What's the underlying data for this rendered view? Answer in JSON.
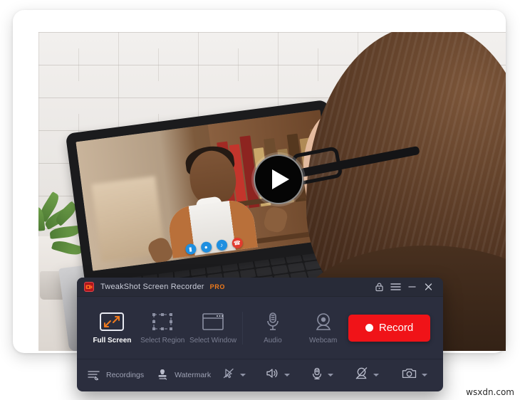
{
  "app": {
    "title": "TweakShot Screen Recorder",
    "badge": "PRO",
    "logo_icon": "app-logo-camera-icon"
  },
  "titlebar": {
    "buttons": [
      {
        "name": "lock-icon",
        "label": ""
      },
      {
        "name": "menu-icon",
        "label": ""
      },
      {
        "name": "minimize-icon",
        "label": ""
      },
      {
        "name": "close-icon",
        "label": ""
      }
    ]
  },
  "capture_modes": [
    {
      "id": "full-screen",
      "label": "Full Screen",
      "icon": "fullscreen-arrows-icon",
      "selected": true
    },
    {
      "id": "select-region",
      "label": "Select Region",
      "icon": "dashed-region-icon",
      "selected": false
    },
    {
      "id": "select-window",
      "label": "Select Window",
      "icon": "window-icon",
      "selected": false
    },
    {
      "id": "audio",
      "label": "Audio",
      "icon": "microphone-icon",
      "selected": false
    },
    {
      "id": "webcam",
      "label": "Webcam",
      "icon": "webcam-icon",
      "selected": false
    }
  ],
  "record_button": {
    "label": "Record",
    "icon": "record-dot-icon",
    "color": "#f01318"
  },
  "bottom_toolbar": [
    {
      "id": "recordings",
      "label": "Recordings",
      "icon": "recordings-list-icon",
      "has_caret": false
    },
    {
      "id": "watermark",
      "label": "Watermark",
      "icon": "stamp-icon",
      "has_caret": false
    },
    {
      "id": "cursor",
      "label": "",
      "icon": "cursor-disabled-icon",
      "has_caret": true
    },
    {
      "id": "speaker",
      "label": "",
      "icon": "speaker-icon",
      "has_caret": true
    },
    {
      "id": "microphone",
      "label": "",
      "icon": "microphone-icon",
      "has_caret": true
    },
    {
      "id": "webcam-off",
      "label": "",
      "icon": "webcam-disabled-icon",
      "has_caret": true
    },
    {
      "id": "screenshot",
      "label": "",
      "icon": "camera-icon",
      "has_caret": true
    }
  ],
  "hero_image": {
    "description": "Woman with glasses watching a video call on a laptop at a white desk",
    "play_button_icon": "play-icon"
  },
  "video_call_controls": [
    {
      "icon": "video-icon",
      "color": "#1f8fe0"
    },
    {
      "icon": "mic-icon",
      "color": "#1f8fe0"
    },
    {
      "icon": "speaker-icon",
      "color": "#1f8fe0"
    },
    {
      "icon": "hangup-icon",
      "color": "#e23b2e"
    }
  ],
  "page_watermark": "wsxdn.com",
  "colors": {
    "panel_bg": "#2b2e3e",
    "titlebar_bg": "#282b38",
    "accent_orange": "#f07a1a",
    "record_red": "#f01318",
    "muted_text": "#7b7f92"
  }
}
